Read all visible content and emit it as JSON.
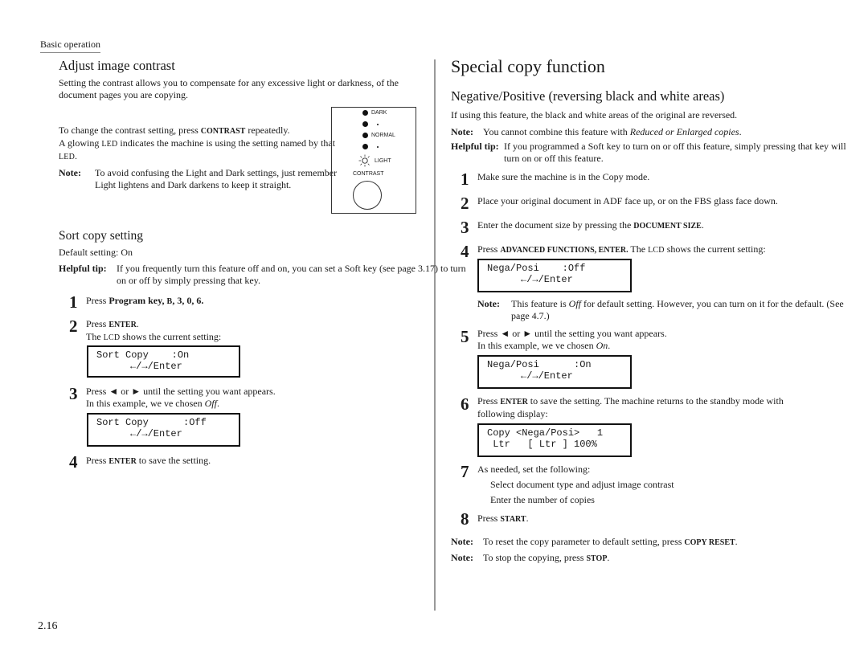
{
  "header": {
    "section_label": "Basic operation"
  },
  "left": {
    "contrast": {
      "title": "Adjust image contrast",
      "intro": "Setting the contrast allows you to compensate for any excessive light or darkness, of the document pages you are copying.",
      "instruction_pre": "To change the contrast setting, press ",
      "instruction_key": "CONTRAST",
      "instruction_post": " repeatedly.",
      "led_pre": "A glowing ",
      "led_key": "LED",
      "led_mid": " indicates the machine is using the setting named by that ",
      "led_key2": "LED",
      "led_post": ".",
      "note_label": "Note:",
      "note_text": "To avoid confusing the Light and Dark settings, just remember  Light lightens and Dark darkens  to keep it straight.",
      "panel": {
        "levels": [
          "DARK",
          "•",
          "NORMAL",
          "•",
          "LIGHT"
        ],
        "button_label": "CONTRAST"
      }
    },
    "sort": {
      "title": "Sort copy setting",
      "default": "Default setting: On",
      "tip_label": "Helpful tip:",
      "tip_text": "If you frequently turn this feature off and on, you can set a Soft key (see page 3.17) to turn on or off by simply pressing that key.",
      "steps": [
        {
          "num": "1",
          "pre": "Press ",
          "bold": "Program key, ",
          "key": "B",
          "bold2": ", 3, 0, 6."
        },
        {
          "num": "2",
          "pre": "Press ",
          "key": "ENTER",
          "post": ".",
          "line2_pre": "The ",
          "line2_key": "LCD",
          "line2_post": " shows the current setting:",
          "lcd": {
            "line1": "Sort Copy    :On",
            "line2": "←/→/Enter"
          }
        },
        {
          "num": "3",
          "line1": "Press ◄ or ► until the setting you want appears.",
          "line2_pre": "In this example, we ve chosen ",
          "line2_italic": "Off",
          "line2_post": ".",
          "lcd": {
            "line1": "Sort Copy      :Off",
            "line2": "←/→/Enter"
          }
        },
        {
          "num": "4",
          "pre": "Press ",
          "key": "ENTER",
          "post": " to save the setting."
        }
      ]
    },
    "page_number": "2.16"
  },
  "right": {
    "title": "Special copy function",
    "subtitle": "Negative/Positive (reversing black and white areas)",
    "intro": "If using this feature, the black and white areas of the original are reversed.",
    "note1_label": "Note:",
    "note1_pre": "You cannot combine this feature with ",
    "note1_italic": "Reduced or Enlarged copies",
    "note1_post": ".",
    "tip_label": "Helpful tip:",
    "tip_text": "If you programmed a Soft key to turn on or off this feature, simply pressing that key will turn on or off this feature.",
    "steps": [
      {
        "num": "1",
        "text": "Make sure the machine is in the Copy mode."
      },
      {
        "num": "2",
        "text": "Place your original document in ADF face up, or on the FBS glass face down."
      },
      {
        "num": "3",
        "pre": "Enter the document size by pressing the ",
        "key": "DOCUMENT SIZE",
        "post": "."
      },
      {
        "num": "4",
        "pre": "Press ",
        "key": "ADVANCED FUNCTIONS, ENTER.",
        "mid": " The ",
        "key2": "LCD",
        "post": " shows the current setting:",
        "lcd": {
          "line1": "Nega/Posi    :Off",
          "line2": "←/→/Enter"
        },
        "note_label": "Note:",
        "note_pre": "This feature is ",
        "note_italic": "Off",
        "note_post": " for default setting.  However, you can turn on it for the default. (See page 4.7.)"
      },
      {
        "num": "5",
        "line1": "Press ◄ or ► until the setting you want appears.",
        "line2_pre": "In this example, we ve chosen ",
        "line2_italic": "On",
        "line2_post": ".",
        "lcd": {
          "line1": "Nega/Posi      :On",
          "line2": "←/→/Enter"
        }
      },
      {
        "num": "6",
        "pre": "Press ",
        "key": "ENTER",
        "post": " to save the setting. The machine returns to the standby mode with following display:",
        "lcd": {
          "line1": "Copy <Nega/Posi>   1",
          "line2": " Ltr   [ Ltr ] 100%"
        }
      },
      {
        "num": "7",
        "text": "As needed, set the following:",
        "sub": [
          "Select document type and adjust image contrast",
          "Enter the number of copies"
        ]
      },
      {
        "num": "8",
        "pre": "Press ",
        "key": "START",
        "post": "."
      }
    ],
    "note2_label": "Note:",
    "note2_pre": "To reset the copy parameter to default setting, press ",
    "note2_key": "COPY RESET",
    "note2_post": ".",
    "note3_label": "Note:",
    "note3_pre": "To stop the copying, press ",
    "note3_key": "STOP",
    "note3_post": "."
  }
}
